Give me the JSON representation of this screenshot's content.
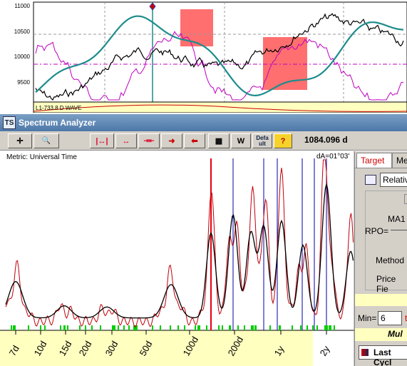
{
  "top_chart": {
    "y_ticks": [
      "11000",
      "10500",
      "10000",
      "9500"
    ],
    "wave_label": "L1-733.8 D WAVE"
  },
  "window": {
    "title": "Spectrum Analyzer",
    "logo": "TS"
  },
  "toolbar": {
    "buttons": [
      {
        "name": "crosshair-button",
        "icon": "crosshair-icon",
        "glyph": "✛"
      },
      {
        "name": "zoom-button",
        "icon": "magnifier-icon",
        "glyph": "🔍"
      },
      {
        "name": "range-bounds-button",
        "icon": "range-bounds-icon",
        "glyph": "|↔|"
      },
      {
        "name": "expand-button",
        "icon": "arrows-out-icon",
        "glyph": "↔"
      },
      {
        "name": "contract-button",
        "icon": "arrows-in-icon",
        "glyph": "⇥⇤"
      },
      {
        "name": "shift-right-button",
        "icon": "arrow-right-icon",
        "glyph": "➜"
      },
      {
        "name": "shift-left-button",
        "icon": "arrow-left-icon",
        "glyph": "⬅"
      },
      {
        "name": "qr-button",
        "icon": "grid-icon",
        "glyph": "▦"
      },
      {
        "name": "w-button",
        "icon": "w-icon",
        "glyph": "W"
      },
      {
        "name": "default-button",
        "icon": "default-icon",
        "glyph": "Defa ult"
      },
      {
        "name": "help-button",
        "icon": "help-icon",
        "glyph": "?"
      }
    ],
    "readout": "1084.096 d"
  },
  "spectrum": {
    "metric_label": "Metric: Universal Time",
    "da_label": "dA=01°03'",
    "x_ticks": [
      "7d",
      "10d",
      "15d",
      "20d",
      "30d",
      "50d",
      "100d",
      "200d",
      "1y",
      "2y"
    ]
  },
  "right_panel": {
    "tab_target": "Target",
    "tab_me": "Me",
    "relative_label": "Relativ",
    "ma1_label": "MA1",
    "rpo_label": "RPO=",
    "method_label": "Method",
    "price_label": "Price Fie",
    "min_label": "Min=",
    "min_value": "6",
    "mult_label": "Mul",
    "last_cycle_label": "Last Cycl"
  },
  "colors": {
    "accent_red": "#e8000f",
    "teal": "#1e8c8c",
    "magenta": "#c000c0",
    "highlight": "#ff6f6f",
    "bottom_band": "#ffffc0"
  }
}
